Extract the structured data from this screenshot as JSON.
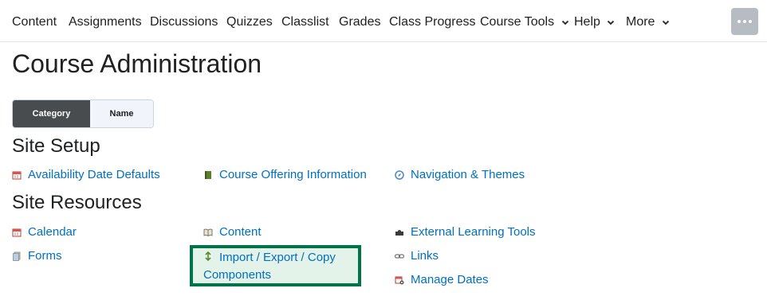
{
  "navbar": {
    "items": [
      {
        "label": "Content"
      },
      {
        "label": "Assignments"
      },
      {
        "label": "Discussions"
      },
      {
        "label": "Quizzes"
      },
      {
        "label": "Classlist"
      },
      {
        "label": "Grades"
      },
      {
        "label": "Class Progress"
      },
      {
        "label": "Course Tools"
      },
      {
        "label": "Help"
      },
      {
        "label": "More"
      }
    ]
  },
  "page": {
    "title": "Course Administration"
  },
  "view_toggle": {
    "category_label": "Category",
    "name_label": "Name",
    "selected": "Category"
  },
  "sections": [
    {
      "heading": "Site Setup",
      "tools": [
        {
          "label": "Availability Date Defaults",
          "icon": "calendar-icon"
        },
        {
          "label": "Course Offering Information",
          "icon": "book-icon"
        },
        {
          "label": "Navigation & Themes",
          "icon": "compass-icon"
        }
      ]
    },
    {
      "heading": "Site Resources",
      "tools": [
        {
          "label": "Calendar",
          "icon": "calendar-icon"
        },
        {
          "label": "Content",
          "icon": "open-book-icon"
        },
        {
          "label": "External Learning Tools",
          "icon": "puzzle-icon"
        },
        {
          "label": "Forms",
          "icon": "forms-icon"
        },
        {
          "label": "Import / Export / Copy",
          "label_line2": "Components",
          "icon": "import-export-icon"
        },
        {
          "label": "Links",
          "icon": "chain-link-icon"
        },
        {
          "label": "Manage Dates",
          "icon": "calendar-gear-icon"
        }
      ]
    }
  ],
  "colors": {
    "link": "#006fbf",
    "highlight_border": "#007348",
    "toggle_active": "#494c4e"
  }
}
